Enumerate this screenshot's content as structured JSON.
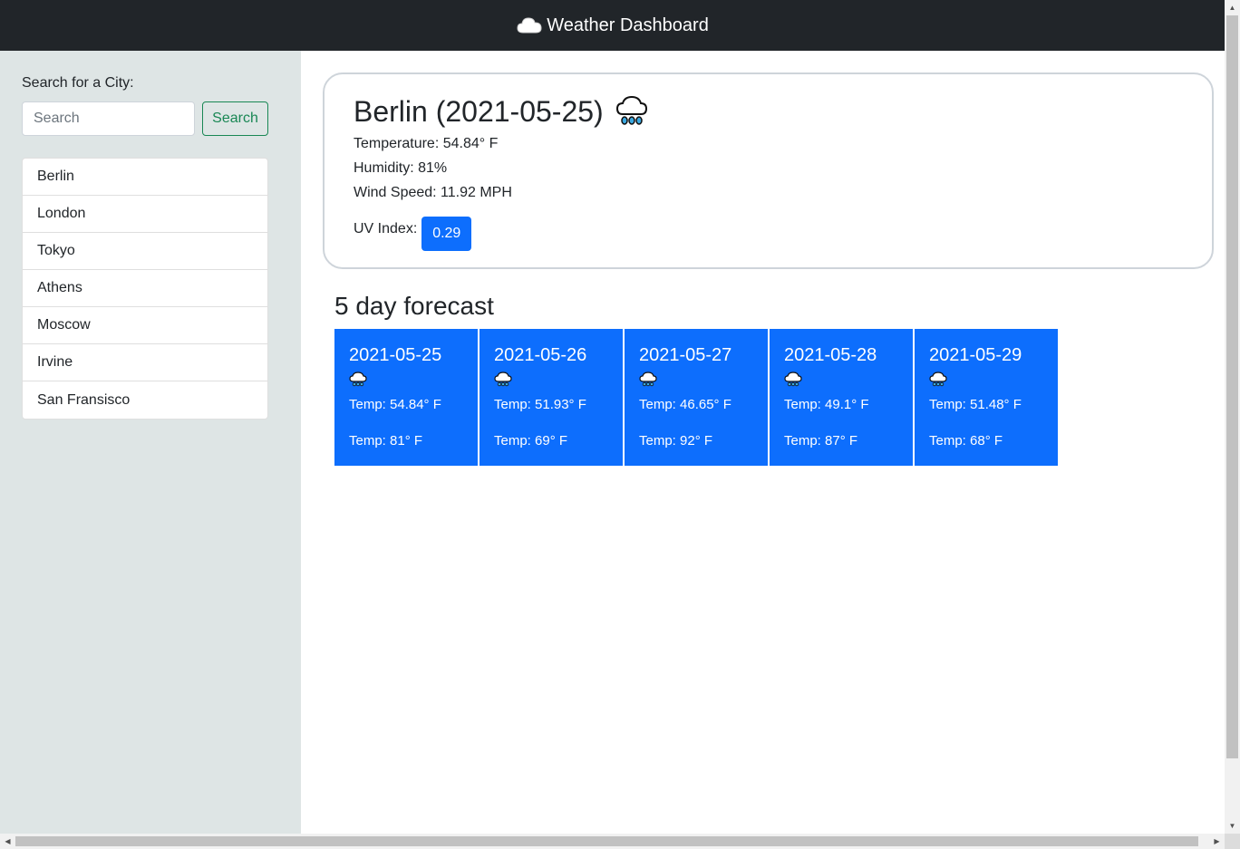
{
  "header": {
    "title": "Weather Dashboard",
    "icon": "cloud-icon"
  },
  "sidebar": {
    "search_label": "Search for a City:",
    "search_placeholder": "Search",
    "search_button": "Search",
    "cities": [
      "Berlin",
      "London",
      "Tokyo",
      "Athens",
      "Moscow",
      "Irvine",
      "San Fransisco"
    ]
  },
  "current": {
    "title": "Berlin (2021-05-25)",
    "icon": "rain-cloud-icon",
    "temperature": "Temperature: 54.84° F",
    "humidity": "Humidity: 81%",
    "wind": "Wind Speed: 11.92 MPH",
    "uv_label": "UV Index:",
    "uv_value": "0.29"
  },
  "forecast": {
    "title": "5 day forecast",
    "days": [
      {
        "date": "2021-05-25",
        "icon": "rain-cloud-icon",
        "temp": "Temp: 54.84° F",
        "humidity": "Temp: 81° F"
      },
      {
        "date": "2021-05-26",
        "icon": "rain-cloud-icon",
        "temp": "Temp: 51.93° F",
        "humidity": "Temp: 69° F"
      },
      {
        "date": "2021-05-27",
        "icon": "rain-cloud-icon",
        "temp": "Temp: 46.65° F",
        "humidity": "Temp: 92° F"
      },
      {
        "date": "2021-05-28",
        "icon": "rain-cloud-icon",
        "temp": "Temp: 49.1° F",
        "humidity": "Temp: 87° F"
      },
      {
        "date": "2021-05-29",
        "icon": "rain-cloud-icon",
        "temp": "Temp: 51.48° F",
        "humidity": "Temp: 68° F"
      }
    ]
  },
  "colors": {
    "navbar": "#212529",
    "sidebar": "#dee5e5",
    "primary": "#0d6efd",
    "success": "#198754"
  }
}
